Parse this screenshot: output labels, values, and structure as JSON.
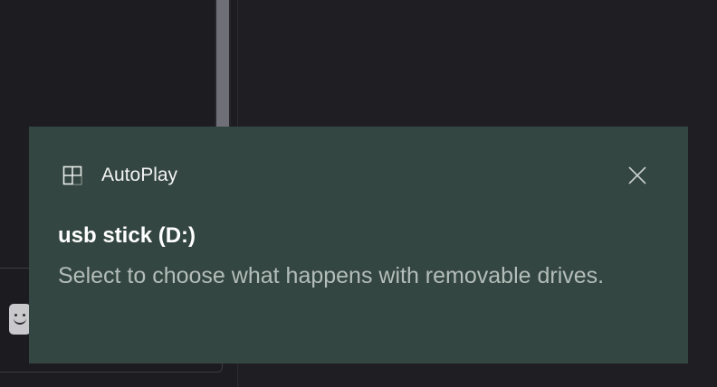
{
  "notification": {
    "app_name": "AutoPlay",
    "app_icon": "autoplay-icon",
    "close_icon": "close-icon",
    "title": "usb stick (D:)",
    "body": "Select to choose what happens with removable drives."
  },
  "colors": {
    "toast_background": "#344641",
    "desktop_background": "#1f1f23",
    "title_text": "#ffffff",
    "body_text": "#b3bdb9"
  }
}
